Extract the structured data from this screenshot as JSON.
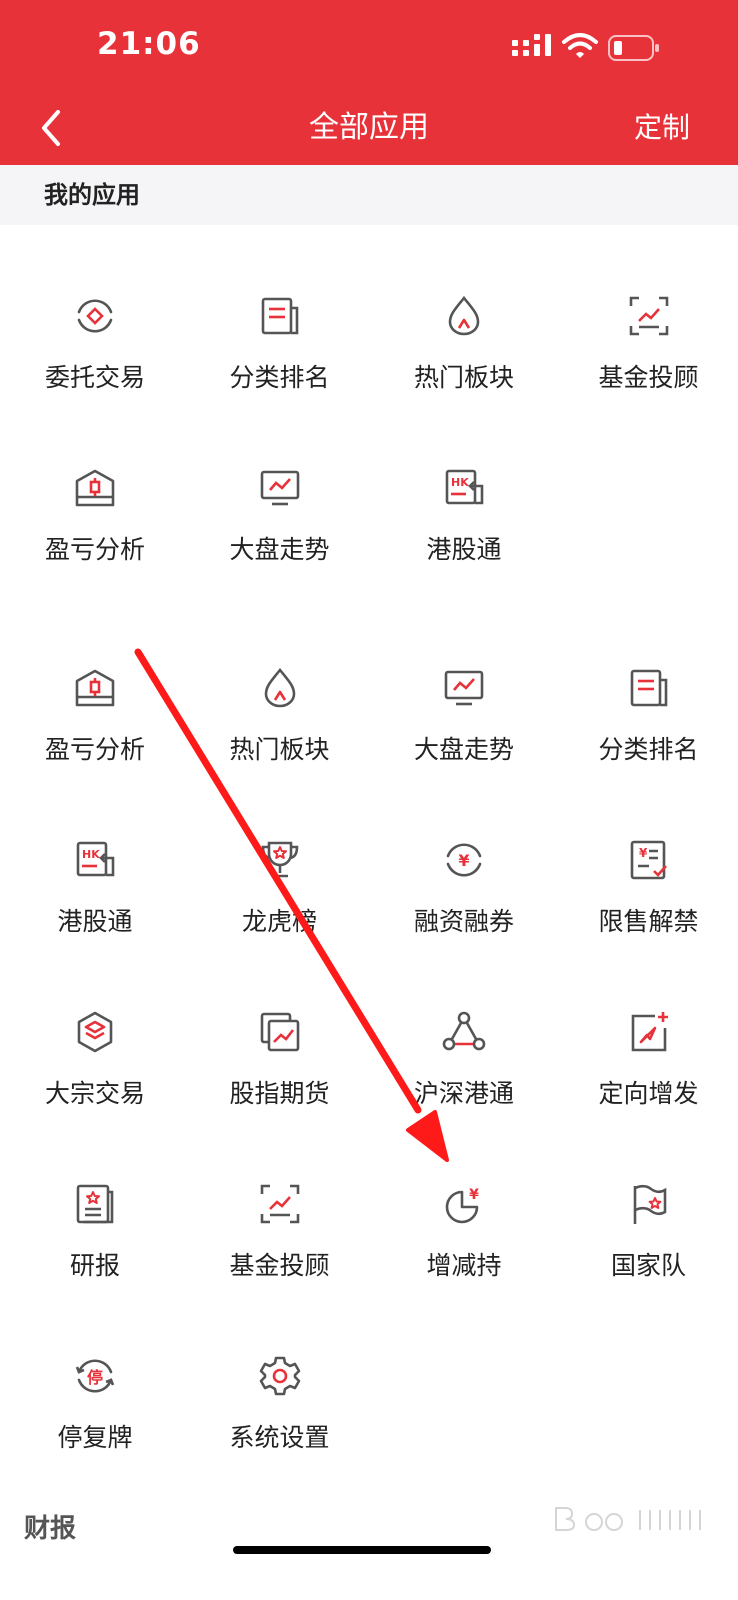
{
  "status_bar": {
    "time": "21:06"
  },
  "nav": {
    "title": "全部应用",
    "custom_label": "定制"
  },
  "sections": {
    "mine_title": "我的应用",
    "next_title": "财报"
  },
  "mine_apps": [
    {
      "label": "委托交易",
      "icon": "entrust-trade-icon"
    },
    {
      "label": "分类排名",
      "icon": "category-rank-icon"
    },
    {
      "label": "热门板块",
      "icon": "flame-icon"
    },
    {
      "label": "基金投顾",
      "icon": "fund-advisor-icon"
    },
    {
      "label": "盈亏分析",
      "icon": "profit-loss-icon"
    },
    {
      "label": "大盘走势",
      "icon": "market-trend-icon"
    },
    {
      "label": "港股通",
      "icon": "hk-connect-icon"
    }
  ],
  "all_apps": [
    {
      "label": "盈亏分析",
      "icon": "profit-loss-icon"
    },
    {
      "label": "热门板块",
      "icon": "flame-icon"
    },
    {
      "label": "大盘走势",
      "icon": "market-trend-icon"
    },
    {
      "label": "分类排名",
      "icon": "category-rank-icon"
    },
    {
      "label": "港股通",
      "icon": "hk-connect-icon"
    },
    {
      "label": "龙虎榜",
      "icon": "trophy-icon"
    },
    {
      "label": "融资融券",
      "icon": "margin-trading-icon"
    },
    {
      "label": "限售解禁",
      "icon": "restricted-release-icon"
    },
    {
      "label": "大宗交易",
      "icon": "block-trade-icon"
    },
    {
      "label": "股指期货",
      "icon": "index-futures-icon"
    },
    {
      "label": "沪深港通",
      "icon": "stock-connect-icon"
    },
    {
      "label": "定向增发",
      "icon": "private-placement-icon"
    },
    {
      "label": "研报",
      "icon": "research-report-icon"
    },
    {
      "label": "基金投顾",
      "icon": "fund-advisor-icon"
    },
    {
      "label": "增减持",
      "icon": "holding-change-icon"
    },
    {
      "label": "国家队",
      "icon": "national-team-icon"
    },
    {
      "label": "停复牌",
      "icon": "suspension-icon"
    },
    {
      "label": "系统设置",
      "icon": "gear-icon"
    }
  ],
  "colors": {
    "brand": "#e8323a",
    "icon_gray": "#555555",
    "annotation": "#ff1a1a"
  }
}
